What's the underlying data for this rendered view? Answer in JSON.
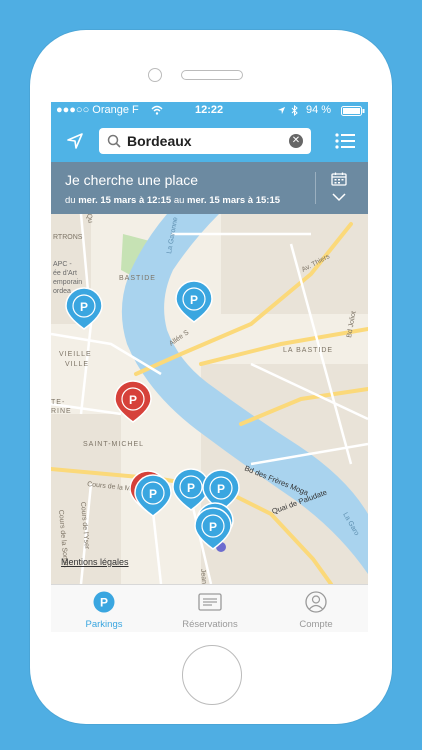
{
  "status": {
    "carrier": "●●●○○ Orange F",
    "time": "12:22",
    "battery": "94 %"
  },
  "search": {
    "value": "Bordeaux"
  },
  "banner": {
    "title": "Je cherche une place",
    "du": "du",
    "start": "mer. 15 mars à 12:15",
    "au": "au",
    "end": "mer. 15 mars à 15:15"
  },
  "map": {
    "labels": {
      "chartrons": "RTRONS",
      "capc1": "APC -",
      "capc2": "ée d'Art",
      "capc3": "emporain",
      "capc4": "ordea",
      "bastide_n": "BASTIDE",
      "la_bastide": "LA BASTIDE",
      "vieille1": "VIEILLE",
      "vieille2": "VILLE",
      "te": "TE-",
      "rine": "RINE",
      "st_michel": "SAINT-MICHEL",
      "garonne": "La Garonne",
      "garonne2": "La Garo",
      "thiers": "Av. Thiers",
      "joliot": "Bd Joliot",
      "allee": "Allée S",
      "cours_marne": "Cours de la Marne",
      "cours_yser": "Cours de l'Yser",
      "cours_somme": "Cours de la Somm",
      "bd_freres": "Bd des Frères Moga",
      "quai_paludate": "Quai de Paludate",
      "jean": "Jean",
      "qu": "Qu"
    },
    "pin_glyph": "P",
    "legal": "Mentions légales",
    "colors": {
      "water": "#a9d3ee",
      "park": "#c6e2b4",
      "pin_blue": "#3aa6e0",
      "pin_red": "#d6413a"
    }
  },
  "tabs": [
    {
      "label": "Parkings",
      "icon": "parking-icon"
    },
    {
      "label": "Réservations",
      "icon": "ticket-icon"
    },
    {
      "label": "Compte",
      "icon": "account-icon"
    }
  ]
}
